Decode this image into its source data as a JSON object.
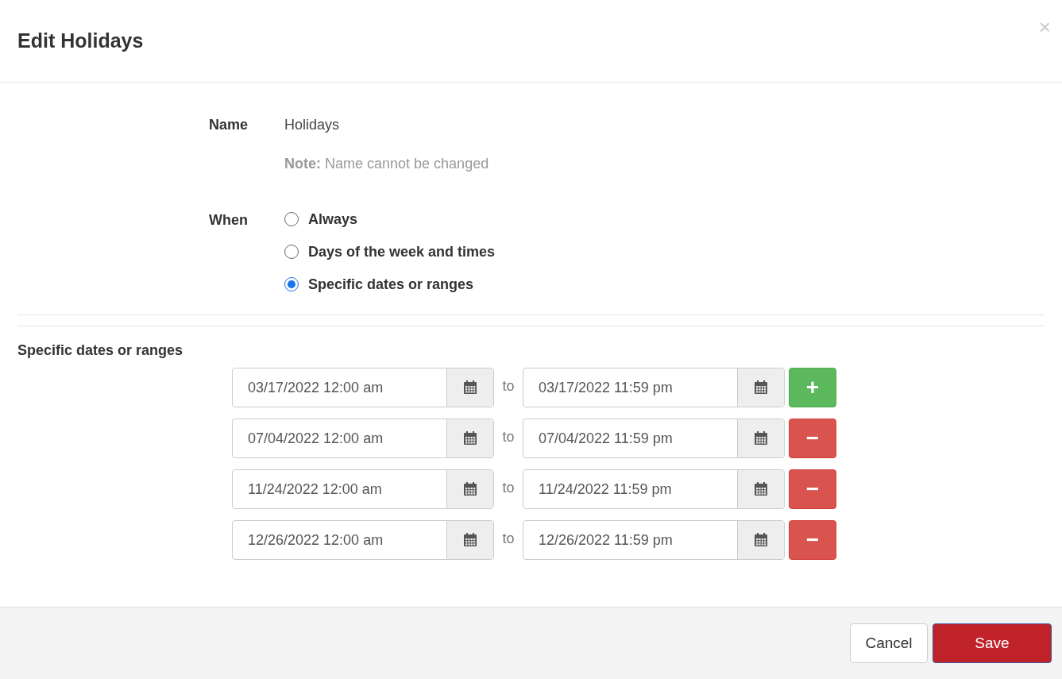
{
  "dialog": {
    "title": "Edit Holidays",
    "close": "×"
  },
  "name_field": {
    "label": "Name",
    "value": "Holidays",
    "note_label": "Note:",
    "note": "Name cannot be changed"
  },
  "when": {
    "label": "When",
    "options": [
      {
        "label": "Always",
        "selected": false
      },
      {
        "label": "Days of the week and times",
        "selected": false
      },
      {
        "label": "Specific dates or ranges",
        "selected": true
      }
    ]
  },
  "ranges": {
    "heading": "Specific dates or ranges",
    "rows": [
      {
        "start": "03/17/2022 12:00 am",
        "separator": "to",
        "end": "03/17/2022 11:59 pm",
        "kind": "add",
        "button": "+"
      },
      {
        "start": "07/04/2022 12:00 am",
        "separator": "to",
        "end": "07/04/2022 11:59 pm",
        "kind": "remove",
        "button": "−"
      },
      {
        "start": "11/24/2022 12:00 am",
        "separator": "to",
        "end": "11/24/2022 11:59 pm",
        "kind": "remove",
        "button": "−"
      },
      {
        "start": "12/26/2022 12:00 am",
        "separator": "to",
        "end": "12/26/2022 11:59 pm",
        "kind": "remove",
        "button": "−"
      }
    ]
  },
  "footer": {
    "buttons": [
      {
        "label": "Cancel",
        "kind": "secondary"
      },
      {
        "label": "Save",
        "kind": "primary"
      }
    ]
  }
}
